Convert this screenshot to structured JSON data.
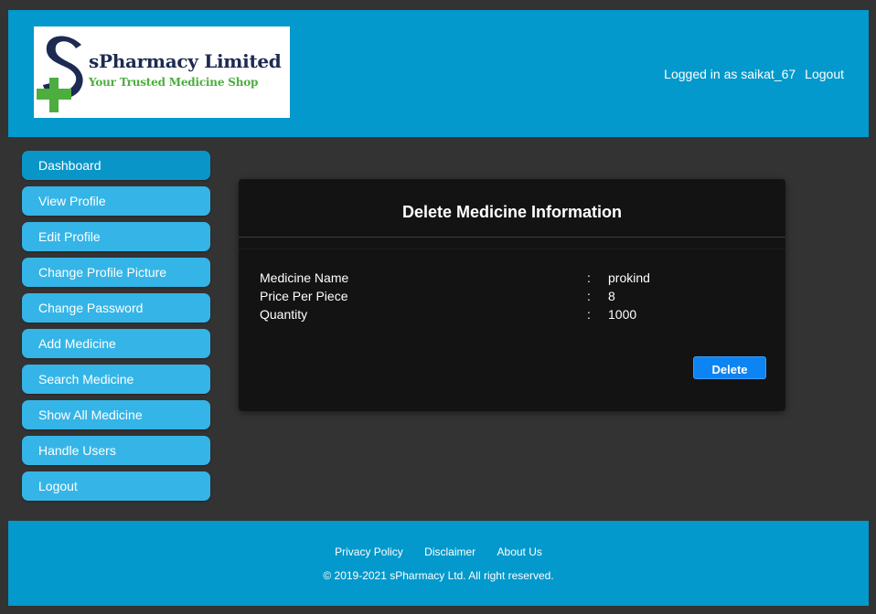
{
  "header": {
    "logo": {
      "title": "sPharmacy Limited",
      "tagline": "Your Trusted Medicine Shop",
      "colors": {
        "s_letter": "#1d2a52",
        "cross": "#4cae3f"
      }
    },
    "logged_in_text": "Logged in as saikat_67",
    "logout_label": "Logout",
    "background": "#0399cc"
  },
  "sidebar": {
    "items": [
      {
        "label": "Dashboard"
      },
      {
        "label": "View Profile"
      },
      {
        "label": "Edit Profile"
      },
      {
        "label": "Change Profile Picture"
      },
      {
        "label": "Change Password"
      },
      {
        "label": "Add Medicine"
      },
      {
        "label": "Search Medicine"
      },
      {
        "label": "Show All Medicine"
      },
      {
        "label": "Handle Users"
      },
      {
        "label": "Logout"
      }
    ]
  },
  "card": {
    "title": "Delete Medicine Information",
    "rows": [
      {
        "label": "Medicine Name",
        "colon": ":",
        "value": "prokind"
      },
      {
        "label": "Price Per Piece",
        "colon": ":",
        "value": "8"
      },
      {
        "label": "Quantity",
        "colon": ":",
        "value": "1000"
      }
    ],
    "delete_label": "Delete",
    "button_color": "#0d84f3"
  },
  "footer": {
    "links": [
      {
        "label": "Privacy Policy"
      },
      {
        "label": "Disclaimer"
      },
      {
        "label": "About Us"
      }
    ],
    "copyright": "© 2019-2021 sPharmacy Ltd. All right reserved."
  }
}
